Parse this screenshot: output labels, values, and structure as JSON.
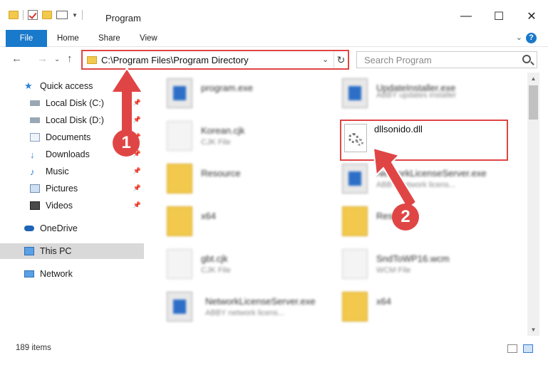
{
  "window": {
    "title": "Program",
    "minimize": "—",
    "maximize": "☐",
    "close": "✕"
  },
  "ribbon": {
    "tabs": [
      "File",
      "Home",
      "Share",
      "View"
    ],
    "expand": "⌄",
    "help": "?"
  },
  "nav": {
    "back": "←",
    "forward": "→",
    "recent": "⌄",
    "up": "↑",
    "address": "C:\\Program Files\\Program Directory",
    "address_dropdown": "⌄",
    "refresh": "↻",
    "search_placeholder": "Search Program"
  },
  "sidebar": {
    "items": [
      {
        "label": "Quick access",
        "icon": "star-icon",
        "pinned": false
      },
      {
        "label": "Local Disk (C:)",
        "icon": "drive-icon",
        "pinned": true
      },
      {
        "label": "Local Disk (D:)",
        "icon": "drive-icon",
        "pinned": true
      },
      {
        "label": "Documents",
        "icon": "documents-icon",
        "pinned": true
      },
      {
        "label": "Downloads",
        "icon": "download-icon",
        "pinned": true
      },
      {
        "label": "Music",
        "icon": "music-icon",
        "pinned": true
      },
      {
        "label": "Pictures",
        "icon": "pictures-icon",
        "pinned": true
      },
      {
        "label": "Videos",
        "icon": "videos-icon",
        "pinned": true
      },
      {
        "label": "OneDrive",
        "icon": "cloud-icon",
        "pinned": false
      },
      {
        "label": "This PC",
        "icon": "computer-icon",
        "pinned": false,
        "selected": true
      },
      {
        "label": "Network",
        "icon": "network-icon",
        "pinned": false
      }
    ],
    "pin_glyph": "📌"
  },
  "files": {
    "left": [
      {
        "name": "program.exe",
        "desc": "",
        "type": "exe"
      },
      {
        "name": "Korean.cjk",
        "desc": "CJK File",
        "type": "doc"
      },
      {
        "name": "Resource",
        "desc": "",
        "type": "folder"
      },
      {
        "name": "x64",
        "desc": "",
        "type": "folder"
      },
      {
        "name": "gbt.cjk",
        "desc": "CJK File",
        "type": "doc"
      },
      {
        "name": "NetworkLicenseServer.exe",
        "desc": "ABBY network licens...",
        "type": "exe"
      }
    ],
    "right": [
      {
        "name": "UpdateInstaller.exe",
        "desc": "ABBY updates installer",
        "type": "exe"
      },
      {
        "name": "",
        "desc": "",
        "type": "hidden"
      },
      {
        "name": "NetworkLicenseServer.exe",
        "desc": "ABBY network licens...",
        "type": "exe"
      },
      {
        "name": "Reso",
        "desc": "",
        "type": "folder"
      },
      {
        "name": "SndToWP16.wcm",
        "desc": "WCM File",
        "type": "doc"
      },
      {
        "name": "x64",
        "desc": "",
        "type": "folder"
      }
    ],
    "highlighted": {
      "name": "dllsonido.dll"
    }
  },
  "status": {
    "count": "189 items"
  },
  "annotations": {
    "step1": "1",
    "step2": "2",
    "accent": "#e04545"
  }
}
